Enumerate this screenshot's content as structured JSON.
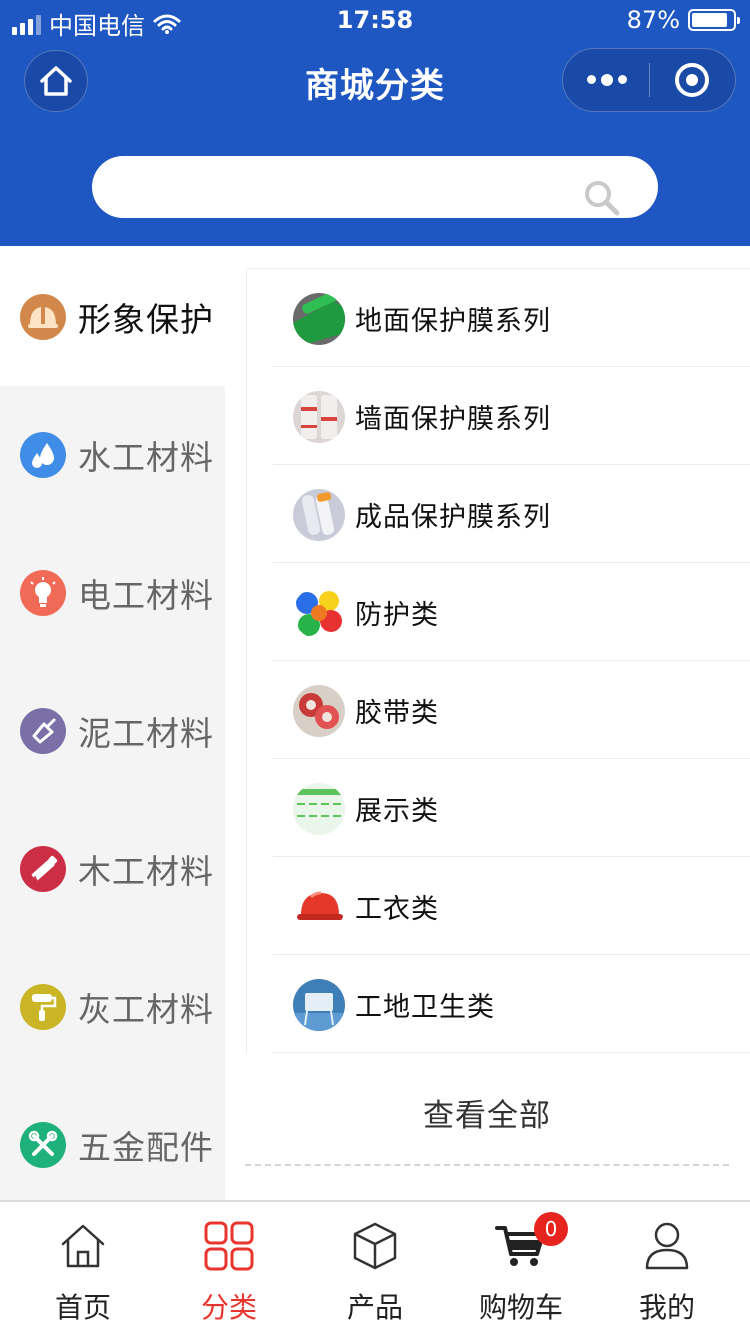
{
  "status_bar": {
    "carrier": "中国电信",
    "time": "17:58",
    "battery_percent": "87%",
    "battery_level": 0.87
  },
  "nav": {
    "title": "商城分类",
    "home_icon": "home-icon",
    "more_icon": "more-dots-icon",
    "close_icon": "target-circle-icon"
  },
  "search": {
    "placeholder": "",
    "value": "",
    "icon": "search-icon"
  },
  "sidebar": {
    "items": [
      {
        "label": "形象保护",
        "icon": "helmet-icon",
        "color": "#d2884a",
        "active": true
      },
      {
        "label": "水工材料",
        "icon": "water-drop-icon",
        "color": "#3f8de6",
        "active": false
      },
      {
        "label": "电工材料",
        "icon": "lightbulb-icon",
        "color": "#f06a55",
        "active": false
      },
      {
        "label": "泥工材料",
        "icon": "trowel-icon",
        "color": "#7a6fa6",
        "active": false
      },
      {
        "label": "木工材料",
        "icon": "saw-icon",
        "color": "#cc2e45",
        "active": false
      },
      {
        "label": "灰工材料",
        "icon": "paint-roller-icon",
        "color": "#c9b526",
        "active": false
      },
      {
        "label": "五金配件",
        "icon": "tools-icon",
        "color": "#1fb17c",
        "active": false
      }
    ]
  },
  "content": {
    "subcategories": [
      {
        "label": "地面保护膜系列",
        "thumb": "green-floor-film-thumb"
      },
      {
        "label": "墙面保护膜系列",
        "thumb": "wall-film-roll-thumb"
      },
      {
        "label": "成品保护膜系列",
        "thumb": "product-film-roll-thumb"
      },
      {
        "label": "防护类",
        "thumb": "colored-caps-thumb"
      },
      {
        "label": "胶带类",
        "thumb": "tape-rolls-thumb"
      },
      {
        "label": "展示类",
        "thumb": "display-banner-thumb"
      },
      {
        "label": "工衣类",
        "thumb": "red-helmet-thumb"
      },
      {
        "label": "工地卫生类",
        "thumb": "sanitation-thumb"
      }
    ],
    "view_all": "查看全部"
  },
  "tabbar": {
    "items": [
      {
        "label": "首页",
        "icon": "home-outline-icon",
        "active": false
      },
      {
        "label": "分类",
        "icon": "grid-icon",
        "active": true
      },
      {
        "label": "产品",
        "icon": "box-icon",
        "active": false
      },
      {
        "label": "购物车",
        "icon": "cart-icon",
        "active": false,
        "badge": "0"
      },
      {
        "label": "我的",
        "icon": "user-icon",
        "active": false
      }
    ]
  },
  "colors": {
    "brand_blue": "#1e57c2",
    "active_red": "#e8352e",
    "badge_red": "#e8241f"
  }
}
